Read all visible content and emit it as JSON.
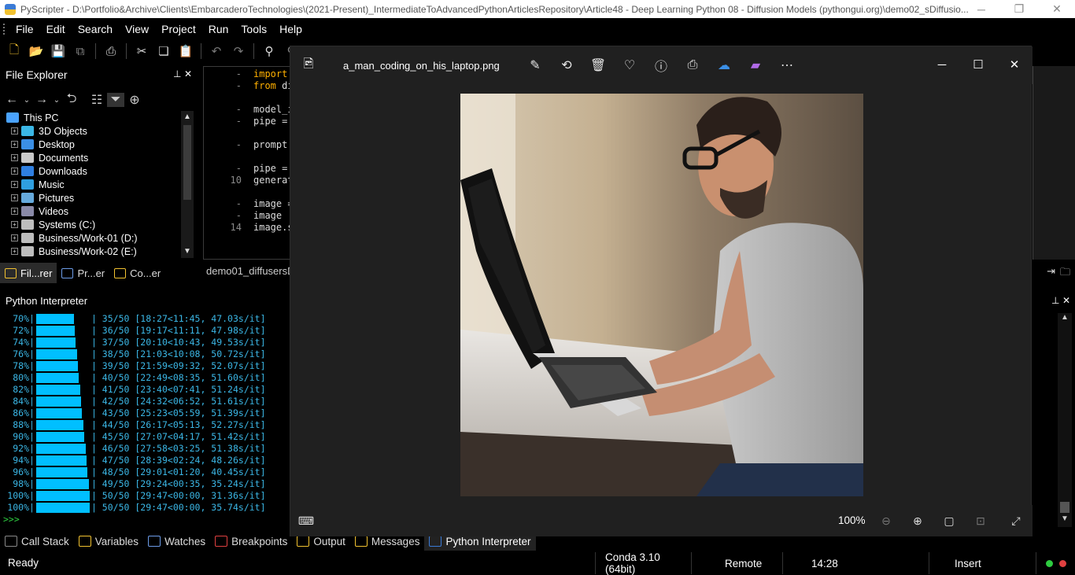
{
  "app": {
    "title": "PyScripter - D:\\Portfolio&Archive\\Clients\\EmbarcaderoTechnologies\\(2021-Present)_IntermediateToAdvancedPythonArticlesRepository\\Article48 - Deep Learning Python 08 - Diffusion Models (pythongui.org)\\demo02_sDiffusio..."
  },
  "menu": [
    "File",
    "Edit",
    "Search",
    "View",
    "Project",
    "Run",
    "Tools",
    "Help"
  ],
  "file_explorer": {
    "title": "File Explorer",
    "tree": [
      {
        "label": "This PC",
        "icon": "computer-icon",
        "color": "#4aa3ff"
      },
      {
        "label": "3D Objects",
        "icon": "cube-icon",
        "color": "#3bb7e6"
      },
      {
        "label": "Desktop",
        "icon": "desktop-icon",
        "color": "#3b8fe6"
      },
      {
        "label": "Documents",
        "icon": "documents-icon",
        "color": "#c9c9c9"
      },
      {
        "label": "Downloads",
        "icon": "download-icon",
        "color": "#2f7fe0"
      },
      {
        "label": "Music",
        "icon": "music-icon",
        "color": "#2f9fe0"
      },
      {
        "label": "Pictures",
        "icon": "pictures-icon",
        "color": "#66aadd"
      },
      {
        "label": "Videos",
        "icon": "videos-icon",
        "color": "#8a8aa8"
      },
      {
        "label": "Systems (C:)",
        "icon": "drive-c-icon",
        "color": "#bdbdbd"
      },
      {
        "label": "Business/Work-01 (D:)",
        "icon": "drive-d-icon",
        "color": "#bdbdbd"
      },
      {
        "label": "Business/Work-02 (E:)",
        "icon": "drive-e-icon",
        "color": "#bdbdbd"
      }
    ],
    "tabs": [
      "Fil...rer",
      "Pr...er",
      "Co...er"
    ]
  },
  "editor": {
    "line_numbers": [
      "-",
      "-",
      "",
      "-",
      "-",
      "",
      "-",
      "",
      "-",
      "10",
      "",
      "-",
      "-",
      "14"
    ],
    "lines": [
      [
        "import",
        ""
      ],
      [
        "from",
        " di"
      ],
      [
        "",
        ""
      ],
      [
        "",
        "model_i"
      ],
      [
        "",
        "pipe ="
      ],
      [
        "",
        ""
      ],
      [
        "",
        "prompt"
      ],
      [
        "",
        ""
      ],
      [
        "",
        "pipe ="
      ],
      [
        "",
        "generat"
      ],
      [
        "",
        ""
      ],
      [
        "",
        "image ="
      ],
      [
        "",
        "image"
      ],
      [
        "",
        "image.s"
      ]
    ],
    "tab_label": "demo01_diffusersD"
  },
  "interpreter": {
    "title": "Python Interpreter",
    "progress": [
      {
        "pct": "70%",
        "fill": 0.7,
        "step": "35/50",
        "timing": "[18:27<11:45, 47.03s/it]"
      },
      {
        "pct": "72%",
        "fill": 0.72,
        "step": "36/50",
        "timing": "[19:17<11:11, 47.98s/it]"
      },
      {
        "pct": "74%",
        "fill": 0.74,
        "step": "37/50",
        "timing": "[20:10<10:43, 49.53s/it]"
      },
      {
        "pct": "76%",
        "fill": 0.76,
        "step": "38/50",
        "timing": "[21:03<10:08, 50.72s/it]"
      },
      {
        "pct": "78%",
        "fill": 0.78,
        "step": "39/50",
        "timing": "[21:59<09:32, 52.07s/it]"
      },
      {
        "pct": "80%",
        "fill": 0.8,
        "step": "40/50",
        "timing": "[22:49<08:35, 51.60s/it]"
      },
      {
        "pct": "82%",
        "fill": 0.82,
        "step": "41/50",
        "timing": "[23:40<07:41, 51.24s/it]"
      },
      {
        "pct": "84%",
        "fill": 0.84,
        "step": "42/50",
        "timing": "[24:32<06:52, 51.61s/it]"
      },
      {
        "pct": "86%",
        "fill": 0.86,
        "step": "43/50",
        "timing": "[25:23<05:59, 51.39s/it]"
      },
      {
        "pct": "88%",
        "fill": 0.88,
        "step": "44/50",
        "timing": "[26:17<05:13, 52.27s/it]"
      },
      {
        "pct": "90%",
        "fill": 0.9,
        "step": "45/50",
        "timing": "[27:07<04:17, 51.42s/it]"
      },
      {
        "pct": "92%",
        "fill": 0.92,
        "step": "46/50",
        "timing": "[27:58<03:25, 51.38s/it]"
      },
      {
        "pct": "94%",
        "fill": 0.94,
        "step": "47/50",
        "timing": "[28:39<02:24, 48.26s/it]"
      },
      {
        "pct": "96%",
        "fill": 0.96,
        "step": "48/50",
        "timing": "[29:01<01:20, 40.45s/it]"
      },
      {
        "pct": "98%",
        "fill": 0.98,
        "step": "49/50",
        "timing": "[29:24<00:35, 35.24s/it]"
      },
      {
        "pct": "100%",
        "fill": 1.0,
        "step": "50/50",
        "timing": "[29:47<00:00, 31.36s/it]"
      },
      {
        "pct": "100%",
        "fill": 1.0,
        "step": "50/50",
        "timing": "[29:47<00:00, 35.74s/it]"
      }
    ],
    "prompt": ">>>"
  },
  "bottom_tabs": [
    "Call Stack",
    "Variables",
    "Watches",
    "Breakpoints",
    "Output",
    "Messages",
    "Python Interpreter"
  ],
  "status": {
    "state": "Ready",
    "interpreter": "Conda 3.10 (64bit)",
    "mode": "Remote",
    "position": "14:28",
    "insert": "Insert"
  },
  "viewer": {
    "filename": "a_man_coding_on_his_laptop.png",
    "zoom": "100%"
  }
}
